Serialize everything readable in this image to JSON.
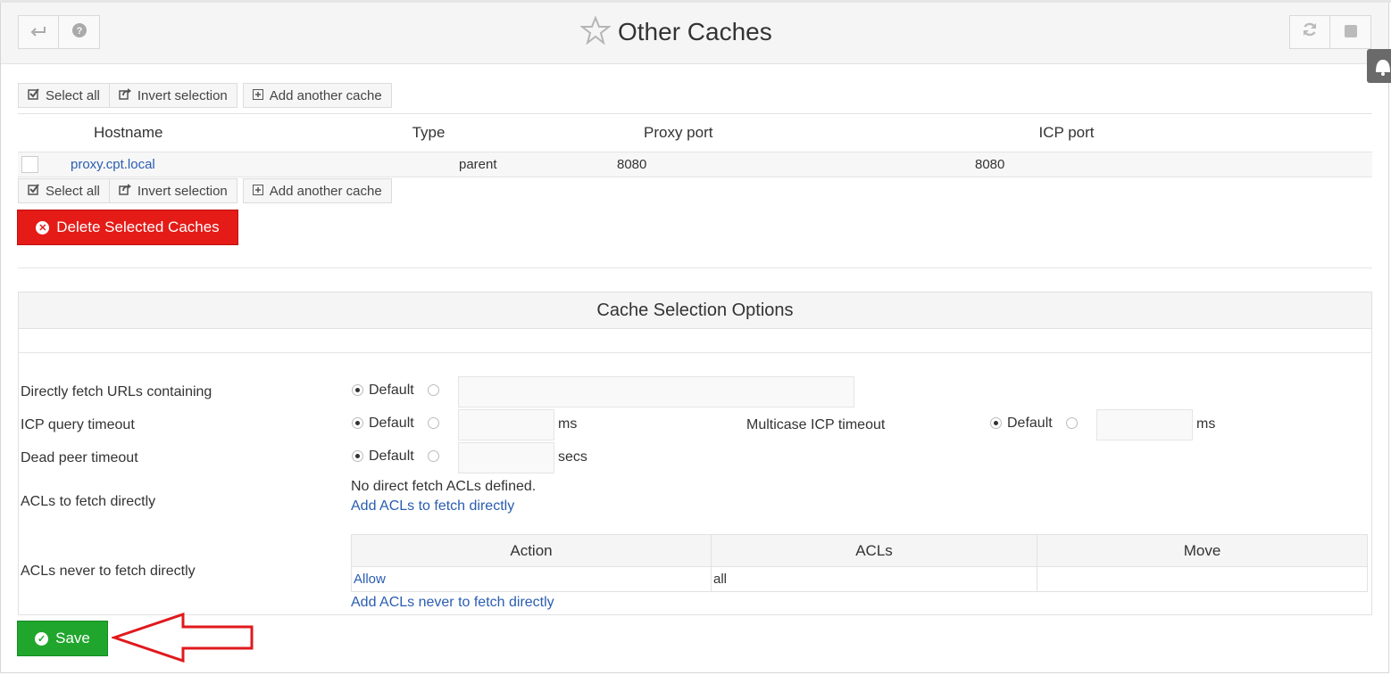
{
  "page": {
    "title": "Other Caches",
    "icons": {
      "back": "return-arrow-icon",
      "help": "question-circle-icon",
      "refresh": "refresh-icon",
      "stop": "stop-icon",
      "favorite": "star-outline-icon",
      "notify": "bell-icon"
    }
  },
  "toolbar": {
    "select_all": "Select all",
    "invert_selection": "Invert selection",
    "add_cache": "Add another cache"
  },
  "cache_table": {
    "columns": [
      "Hostname",
      "Type",
      "Proxy port",
      "ICP port"
    ],
    "rows": [
      {
        "hostname": "proxy.cpt.local",
        "type": "parent",
        "proxy_port": "8080",
        "icp_port": "8080"
      }
    ]
  },
  "delete_button": "Delete Selected Caches",
  "options": {
    "heading": "Cache Selection Options",
    "direct_fetch_label": "Directly fetch URLs containing",
    "icp_timeout_label": "ICP query timeout",
    "multicast_icp_label": "Multicase ICP timeout",
    "dead_peer_label": "Dead peer timeout",
    "acl_direct_label": "ACLs to fetch directly",
    "acl_never_label": "ACLs never to fetch directly",
    "default_option": "Default",
    "ms_unit": "ms",
    "secs_unit": "secs",
    "no_direct_acls": "No direct fetch ACLs defined.",
    "add_direct_acl_link": "Add ACLs to fetch directly",
    "add_never_acl_link": "Add ACLs never to fetch directly"
  },
  "acl_table": {
    "columns": [
      "Action",
      "ACLs",
      "Move"
    ],
    "rows": [
      {
        "action": "Allow",
        "acls": "all",
        "move": ""
      }
    ]
  },
  "save_button": "Save",
  "colors": {
    "delete": "#e41b17",
    "save": "#20a62d",
    "link": "#2a5db0",
    "annotation_arrow": "#e0191d"
  }
}
